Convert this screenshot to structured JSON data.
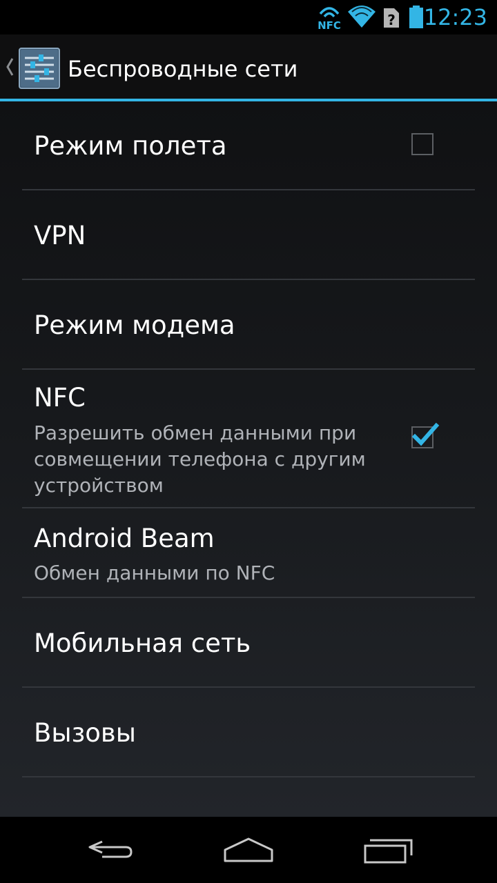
{
  "status_bar": {
    "time": "12:23",
    "nfc_label": "NFC",
    "accent_color": "#33b5e5",
    "icons": [
      "nfc-icon",
      "wifi-icon",
      "sim-unknown-icon",
      "battery-icon"
    ]
  },
  "action_bar": {
    "title": "Беспроводные сети",
    "icon": "settings-sliders-icon"
  },
  "preferences": [
    {
      "title": "Режим полета",
      "summary": "",
      "checkbox": true,
      "checked": false
    },
    {
      "title": "VPN",
      "summary": "",
      "checkbox": false
    },
    {
      "title": "Режим модема",
      "summary": "",
      "checkbox": false
    },
    {
      "title": "NFC",
      "summary": "Разрешить обмен данными при совмещении телефона с другим устройством",
      "checkbox": true,
      "checked": true
    },
    {
      "title": "Android Beam",
      "summary": "Обмен данными по NFC",
      "checkbox": false
    },
    {
      "title": "Мобильная сеть",
      "summary": "",
      "checkbox": false
    },
    {
      "title": "Вызовы",
      "summary": "",
      "checkbox": false
    }
  ],
  "nav_bar": {
    "buttons": [
      "back-icon",
      "home-icon",
      "recent-apps-icon"
    ]
  }
}
